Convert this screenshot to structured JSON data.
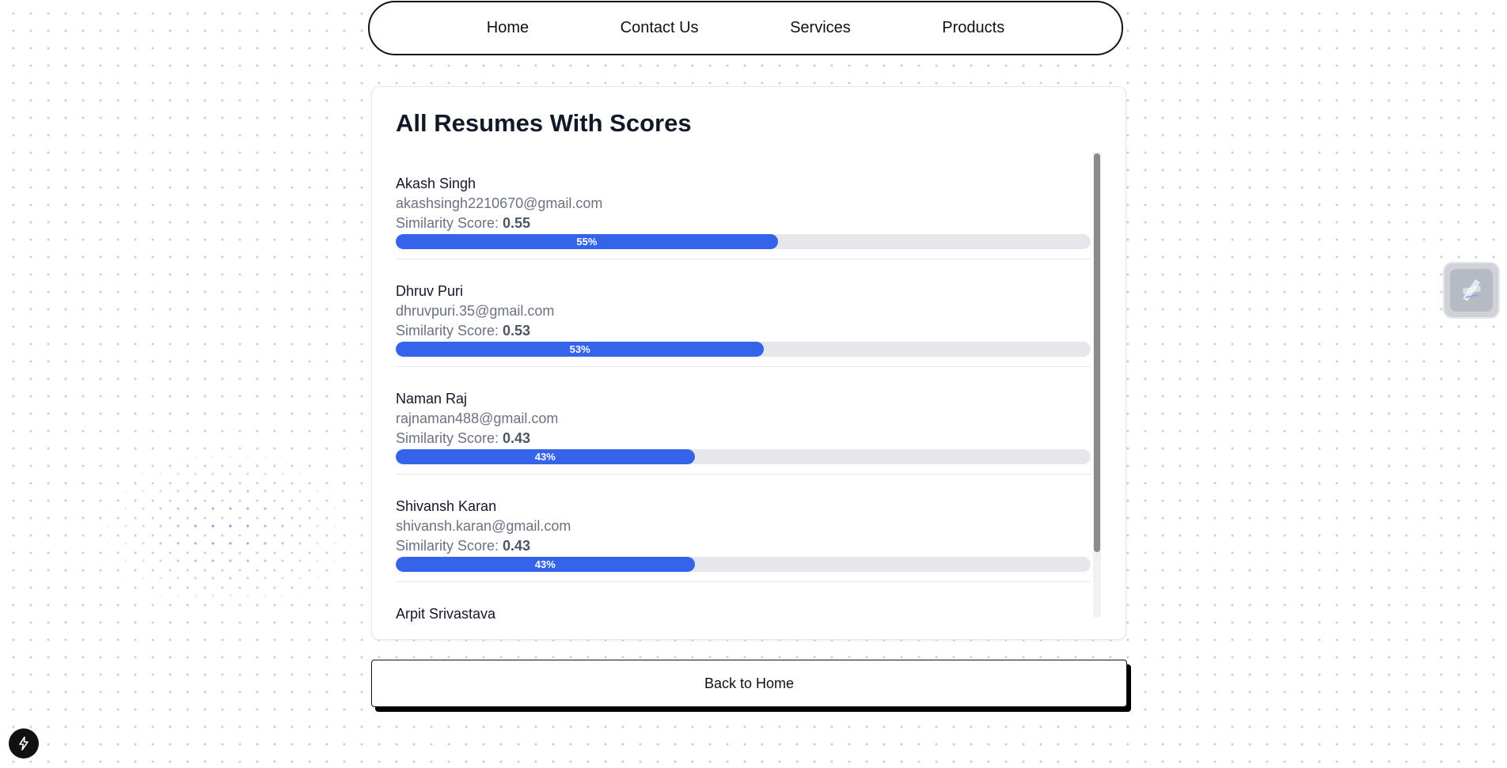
{
  "nav": {
    "items": [
      {
        "label": "Home"
      },
      {
        "label": "Contact Us"
      },
      {
        "label": "Services"
      },
      {
        "label": "Products"
      }
    ]
  },
  "card": {
    "title": "All Resumes With Scores",
    "score_label": "Similarity Score: "
  },
  "resumes": [
    {
      "name": "Akash Singh",
      "email": "akashsingh2210670@gmail.com",
      "score": "0.55",
      "percent_label": "55%",
      "percent": 55
    },
    {
      "name": "Dhruv Puri",
      "email": "dhruvpuri.35@gmail.com",
      "score": "0.53",
      "percent_label": "53%",
      "percent": 53
    },
    {
      "name": "Naman Raj",
      "email": "rajnaman488@gmail.com",
      "score": "0.43",
      "percent_label": "43%",
      "percent": 43
    },
    {
      "name": "Shivansh Karan",
      "email": "shivansh.karan@gmail.com",
      "score": "0.43",
      "percent_label": "43%",
      "percent": 43
    },
    {
      "name": "Arpit Srivastava"
    }
  ],
  "back_button": {
    "label": "Back to Home"
  },
  "colors": {
    "accent": "#3563e9",
    "track": "#e5e7eb",
    "text_primary": "#111827",
    "text_muted": "#6b7280"
  },
  "icons": {
    "side_widget": "extension-widget-icon",
    "bottom_left": "lightning-bolt-icon"
  }
}
